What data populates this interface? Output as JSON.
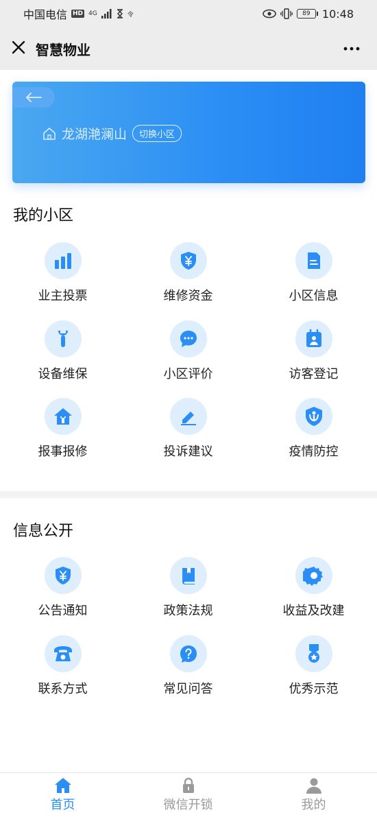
{
  "status_bar": {
    "carrier": "中国电信",
    "hd": "HD",
    "net": "4G",
    "extra": "令",
    "battery": "89",
    "time": "10:48"
  },
  "nav": {
    "title": "智慧物业"
  },
  "banner": {
    "community_name": "龙湖滟澜山",
    "switch_label": "切换小区"
  },
  "my_community": {
    "title": "我的小区",
    "items": [
      {
        "label": "业主投票",
        "icon": "bar-chart-icon"
      },
      {
        "label": "维修资金",
        "icon": "yuan-shield-icon"
      },
      {
        "label": "小区信息",
        "icon": "document-icon"
      },
      {
        "label": "设备维保",
        "icon": "wrench-icon"
      },
      {
        "label": "小区评价",
        "icon": "chat-bubble-icon"
      },
      {
        "label": "访客登记",
        "icon": "calendar-user-icon"
      },
      {
        "label": "报事报修",
        "icon": "house-repair-icon"
      },
      {
        "label": "投诉建议",
        "icon": "edit-icon"
      },
      {
        "label": "疫情防控",
        "icon": "shield-person-icon"
      }
    ]
  },
  "info_public": {
    "title": "信息公开",
    "items": [
      {
        "label": "公告通知",
        "icon": "yuan-shield-icon"
      },
      {
        "label": "政策法规",
        "icon": "book-icon"
      },
      {
        "label": "收益及改建",
        "icon": "gear-icon"
      },
      {
        "label": "联系方式",
        "icon": "telephone-icon"
      },
      {
        "label": "常见问答",
        "icon": "question-icon"
      },
      {
        "label": "优秀示范",
        "icon": "medal-icon"
      }
    ]
  },
  "tabbar": {
    "tabs": [
      {
        "label": "首页",
        "active": true
      },
      {
        "label": "微信开锁",
        "active": false
      },
      {
        "label": "我的",
        "active": false
      }
    ]
  },
  "colors": {
    "accent": "#2b8ef4",
    "icon_bg": "#deeefc",
    "tab_active": "#2b8ef4",
    "tab_inactive": "#9a9a9a"
  }
}
